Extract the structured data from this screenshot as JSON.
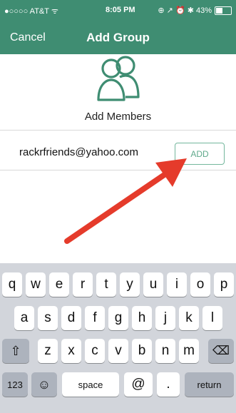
{
  "status": {
    "carrier": "●○○○○ AT&T ᯤ",
    "time": "8:05 PM",
    "right": "⊕ ↗ ⏰ ✱ 43%",
    "battery_level": 0.43
  },
  "nav": {
    "cancel_label": "Cancel",
    "title": "Add Group"
  },
  "section": {
    "add_members_label": "Add Members"
  },
  "member": {
    "email": "rackrfriends@yahoo.com",
    "add_label": "ADD"
  },
  "colors": {
    "brand": "#3f8d72",
    "accent": "#5fa98b",
    "arrow": "#e53b2b"
  },
  "keyboard": {
    "row1": [
      "q",
      "w",
      "e",
      "r",
      "t",
      "y",
      "u",
      "i",
      "o",
      "p"
    ],
    "row2": [
      "a",
      "s",
      "d",
      "f",
      "g",
      "h",
      "j",
      "k",
      "l"
    ],
    "row3": [
      "z",
      "x",
      "c",
      "v",
      "b",
      "n",
      "m"
    ],
    "shift": "⇧",
    "delete": "⌫",
    "numbers": "123",
    "emoji": "☺",
    "space": "space",
    "at": "@",
    "dot": ".",
    "return": "return"
  }
}
